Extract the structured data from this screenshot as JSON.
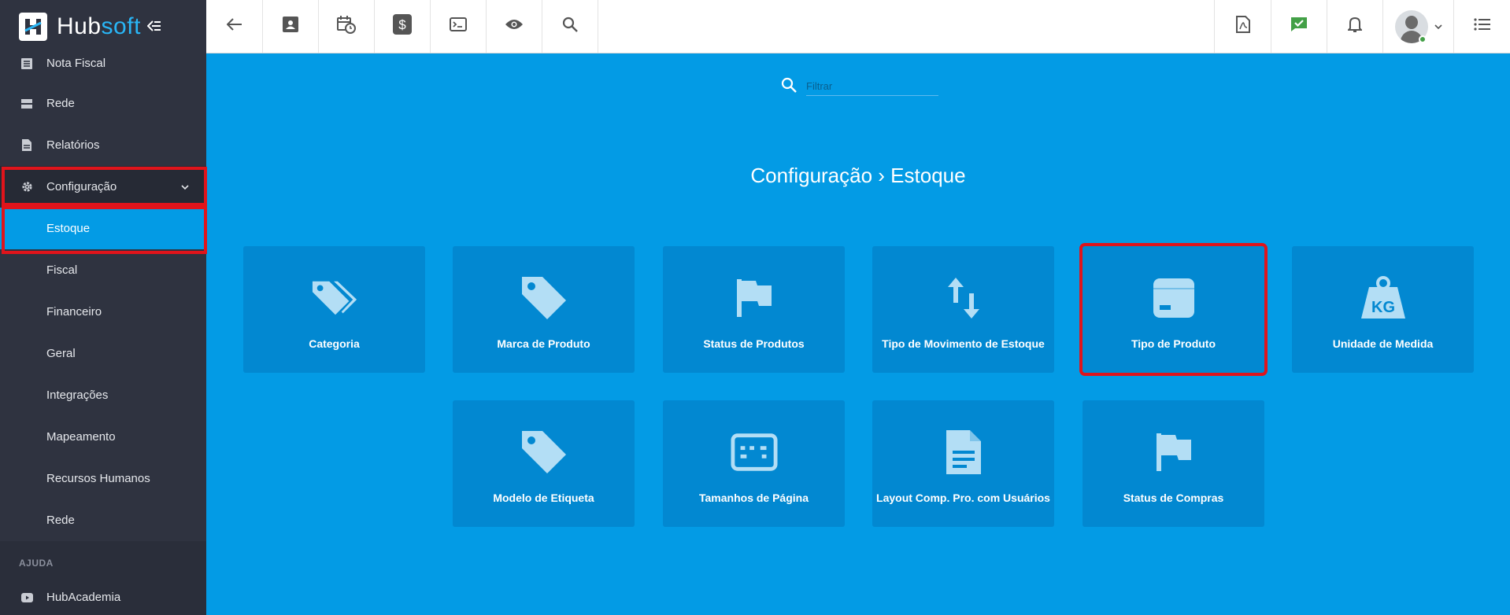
{
  "app": {
    "logo_text_a": "Hub",
    "logo_text_b": "soft"
  },
  "sidebar": {
    "items": [
      {
        "label": "Nota Fiscal",
        "icon": "list-icon"
      },
      {
        "label": "Rede",
        "icon": "server-icon"
      },
      {
        "label": "Relatórios",
        "icon": "document-icon"
      },
      {
        "label": "Configuração",
        "icon": "gear-icon"
      }
    ],
    "subitems": [
      "Estoque",
      "Fiscal",
      "Financeiro",
      "Geral",
      "Integrações",
      "Mapeamento",
      "Recursos Humanos",
      "Rede"
    ],
    "section_help": "AJUDA",
    "help_item": "HubAcademia"
  },
  "filter": {
    "placeholder": "Filtrar"
  },
  "page_title": "Configuração › Estoque",
  "cards": [
    {
      "label": "Categoria",
      "icon": "tags-icon"
    },
    {
      "label": "Marca de Produto",
      "icon": "tag-icon"
    },
    {
      "label": "Status de Produtos",
      "icon": "flag-icon"
    },
    {
      "label": "Tipo de Movimento de Estoque",
      "icon": "swap-vertical-icon"
    },
    {
      "label": "Tipo de Produto",
      "icon": "box-icon"
    },
    {
      "label": "Unidade de Medida",
      "icon": "weight-kg-icon"
    },
    {
      "label": "Modelo de Etiqueta",
      "icon": "tag-icon"
    },
    {
      "label": "Tamanhos de Página",
      "icon": "page-size-icon"
    },
    {
      "label": "Layout Comp. Pro. com Usuários",
      "icon": "document-icon"
    },
    {
      "label": "Status de Compras",
      "icon": "flag-icon"
    }
  ],
  "colors": {
    "sidebar": "#2f3340",
    "main": "#039be5",
    "card": "#0288d1",
    "highlight": "#e0141b"
  }
}
